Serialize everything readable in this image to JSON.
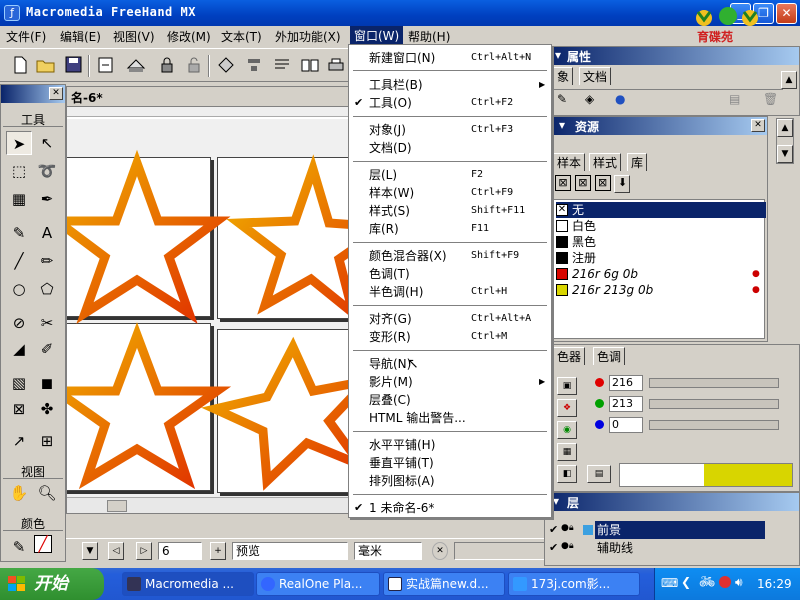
{
  "window": {
    "title": "Macromedia FreeHand MX",
    "logo_text": "育碟苑",
    "btn_minimize": "_",
    "btn_restore": "❐",
    "btn_close": "✕"
  },
  "menubar": {
    "items": [
      "文件(F)",
      "编辑(E)",
      "视图(V)",
      "修改(M)",
      "文本(T)",
      "外加功能(X)",
      "窗口(W)",
      "帮助(H)"
    ],
    "active": "窗口(W)"
  },
  "tools": {
    "title": "工具",
    "view_title": "视图",
    "color_title": "颜色"
  },
  "document": {
    "tab_title": "名-6*"
  },
  "statusbar": {
    "page_value": "6",
    "view_mode": "预览",
    "units": "毫米"
  },
  "window_menu": {
    "items": [
      {
        "label": "新建窗口(N)",
        "shortcut": "Ctrl+Alt+N",
        "checked": false,
        "submenu": false
      },
      {
        "label": "工具栏(B)",
        "shortcut": "",
        "checked": false,
        "submenu": true
      },
      {
        "label": "工具(O)",
        "shortcut": "Ctrl+F2",
        "checked": true,
        "submenu": false
      },
      {
        "label": "对象(J)",
        "shortcut": "Ctrl+F3",
        "checked": false,
        "submenu": false
      },
      {
        "label": "文档(D)",
        "shortcut": "",
        "checked": false,
        "submenu": false
      },
      {
        "label": "层(L)",
        "shortcut": "F2",
        "checked": false,
        "submenu": false
      },
      {
        "label": "样本(W)",
        "shortcut": "Ctrl+F9",
        "checked": false,
        "submenu": false
      },
      {
        "label": "样式(S)",
        "shortcut": "Shift+F11",
        "checked": false,
        "submenu": false
      },
      {
        "label": "库(R)",
        "shortcut": "F11",
        "checked": false,
        "submenu": false
      },
      {
        "label": "颜色混合器(X)",
        "shortcut": "Shift+F9",
        "checked": false,
        "submenu": false
      },
      {
        "label": "色调(T)",
        "shortcut": "",
        "checked": false,
        "submenu": false
      },
      {
        "label": "半色调(H)",
        "shortcut": "Ctrl+H",
        "checked": false,
        "submenu": false
      },
      {
        "label": "对齐(G)",
        "shortcut": "Ctrl+Alt+A",
        "checked": false,
        "submenu": false
      },
      {
        "label": "变形(R)",
        "shortcut": "Ctrl+M",
        "checked": false,
        "submenu": false
      },
      {
        "label": "导航(N)",
        "shortcut": "",
        "checked": false,
        "submenu": false
      },
      {
        "label": "影片(M)",
        "shortcut": "",
        "checked": false,
        "submenu": true
      },
      {
        "label": "层叠(C)",
        "shortcut": "",
        "checked": false,
        "submenu": false
      },
      {
        "label": "HTML 输出警告...",
        "shortcut": "",
        "checked": false,
        "submenu": false
      },
      {
        "label": "水平平铺(H)",
        "shortcut": "",
        "checked": false,
        "submenu": false
      },
      {
        "label": "垂直平铺(T)",
        "shortcut": "",
        "checked": false,
        "submenu": false
      },
      {
        "label": "排列图标(A)",
        "shortcut": "",
        "checked": false,
        "submenu": false
      },
      {
        "label": "1 未命名-6*",
        "shortcut": "",
        "checked": true,
        "submenu": false
      }
    ]
  },
  "properties_panel": {
    "title": "属性",
    "tabs": [
      "象",
      "文档"
    ]
  },
  "assets_panel": {
    "title": "资源",
    "tabs": [
      "样本",
      "样式",
      "库"
    ],
    "swatches": [
      {
        "name": "无",
        "color": "none"
      },
      {
        "name": "白色",
        "color": "#ffffff"
      },
      {
        "name": "黑色",
        "color": "#000000"
      },
      {
        "name": "注册",
        "color": "#000000"
      },
      {
        "name": "216r 6g 0b",
        "color": "#d80600"
      },
      {
        "name": "216r 213g 0b",
        "color": "#d8d500"
      }
    ]
  },
  "mixer_panel": {
    "tabs": [
      "色器",
      "色调"
    ],
    "r": "216",
    "g": "213",
    "b": "0",
    "preview_color": "#d8d500"
  },
  "layers_panel": {
    "title": "层",
    "layers": [
      "前景",
      "辅助线"
    ]
  },
  "taskbar": {
    "start": "开始",
    "tasks": [
      "Macromedia ...",
      "RealOne Pla...",
      "实战篇new.d...",
      "173j.com影..."
    ],
    "clock": "16:29"
  }
}
